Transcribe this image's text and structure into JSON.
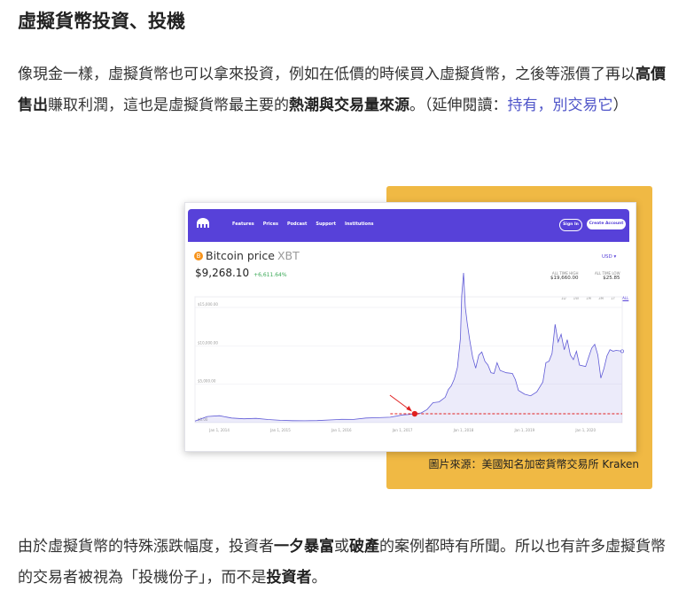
{
  "heading": "虛擬貨幣投資、投機",
  "para1": {
    "t1": "像現金一樣，虛擬貨幣也可以拿來投資，例如在低價的時候買入虛擬貨幣，之後等漲價了再以",
    "b1": "高價售出",
    "t2": "賺取利潤，這也是虛擬貨幣最主要的",
    "b2": "熱潮與交易量來源",
    "t3": "。（延伸閱讀：",
    "link": "持有，別交易它",
    "t4": "）"
  },
  "figure": {
    "colors": {
      "accent_box": "#f0b944",
      "brand": "#5741d9",
      "series": "#5f5ad6",
      "marker": "#e02020"
    },
    "nav": {
      "logo_icon": "kraken-logo-icon",
      "items": [
        "Features",
        "Prices",
        "Podcast",
        "Support",
        "Institutions"
      ],
      "signin": "Sign In",
      "create": "Create Account"
    },
    "coin_icon": "B",
    "title": "Bitcoin price",
    "ticker": "XBT",
    "currency": "USD ▾",
    "price": "$9,268.10",
    "change": "+6,611.64%",
    "ath_high": {
      "label": "ALL TIME HIGH",
      "value": "$19,660.00"
    },
    "ath_low": {
      "label": "ALL TIME LOW",
      "value": "$25.85"
    },
    "ranges": [
      "1D",
      "1W",
      "1M",
      "3M",
      "1Y",
      "ALL"
    ],
    "active_range": "ALL",
    "caption": "圖片來源：美國知名加密貨幣交易所 Kraken"
  },
  "chart_data": {
    "type": "area",
    "x_ticks": [
      "Jan 1, 2014",
      "Jan 1, 2015",
      "Jan 1, 2016",
      "Jan 1, 2017",
      "Jan 1, 2018",
      "Jan 1, 2019",
      "Jan 1, 2020"
    ],
    "y_ticks": [
      "$0.00",
      "$5,000.00",
      "$10,000.00",
      "$15,000.00"
    ],
    "ylim": [
      0,
      15000
    ],
    "x_range": [
      2013.6,
      2020.6
    ],
    "series": [
      {
        "x": [
          2013.6,
          2013.8,
          2014.0,
          2014.2,
          2014.4,
          2014.6,
          2014.8,
          2015.0,
          2015.2,
          2015.4,
          2015.6,
          2015.8,
          2016.0,
          2016.2,
          2016.4,
          2016.6,
          2016.8,
          2017.0,
          2017.1,
          2017.2,
          2017.3,
          2017.4,
          2017.5,
          2017.6,
          2017.7,
          2017.75,
          2017.8,
          2017.85,
          2017.9,
          2017.95,
          2017.97,
          2018.0,
          2018.03,
          2018.06,
          2018.1,
          2018.15,
          2018.2,
          2018.25,
          2018.3,
          2018.35,
          2018.4,
          2018.45,
          2018.5,
          2018.55,
          2018.6,
          2018.7,
          2018.8,
          2018.85,
          2018.9,
          2019.0,
          2019.1,
          2019.2,
          2019.3,
          2019.35,
          2019.4,
          2019.45,
          2019.5,
          2019.55,
          2019.6,
          2019.65,
          2019.7,
          2019.75,
          2019.8,
          2019.85,
          2019.9,
          2020.0,
          2020.05,
          2020.1,
          2020.15,
          2020.2,
          2020.25,
          2020.3,
          2020.35,
          2020.4,
          2020.45,
          2020.5,
          2020.6
        ],
        "values": [
          200,
          800,
          900,
          600,
          500,
          550,
          400,
          300,
          250,
          240,
          260,
          350,
          430,
          420,
          600,
          650,
          700,
          1000,
          1050,
          1150,
          1250,
          1700,
          2600,
          2700,
          3300,
          4300,
          4800,
          5700,
          7200,
          11000,
          16500,
          19500,
          15000,
          13000,
          10800,
          8500,
          7100,
          8800,
          9200,
          8000,
          7500,
          6500,
          6400,
          7800,
          6800,
          6500,
          6400,
          5600,
          4200,
          3700,
          3500,
          4000,
          5300,
          7800,
          8000,
          9000,
          12800,
          10500,
          11500,
          9500,
          10800,
          8800,
          8200,
          9300,
          7500,
          7300,
          8500,
          9700,
          10200,
          8800,
          5800,
          7000,
          8700,
          9500,
          9300,
          9400,
          9300
        ]
      }
    ],
    "marker": {
      "x": 2017.2,
      "y": 1150,
      "guide_y": 1150
    }
  },
  "para2": {
    "t1": "由於虛擬貨幣的特殊漲跌幅度，投資者",
    "b1": "一夕暴富",
    "t2": "或",
    "b2": "破產",
    "t3": "的案例都時有所聞。所以也有許多虛擬貨幣的交易者被視為「投機份子」，而不是",
    "b3": "投資者",
    "t4": "。"
  }
}
